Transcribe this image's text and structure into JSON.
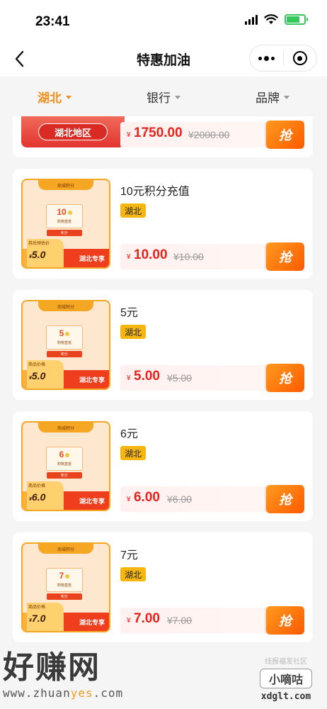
{
  "status": {
    "time": "23:41"
  },
  "nav": {
    "title": "特惠加油"
  },
  "filters": [
    {
      "label": "湖北",
      "active": true
    },
    {
      "label": "银行",
      "active": false
    },
    {
      "label": "品牌",
      "active": false
    }
  ],
  "top_card": {
    "badge": "湖北地区",
    "currency": "¥",
    "price": "1750.00",
    "old_price": "¥2000.00",
    "button": "抢"
  },
  "items": [
    {
      "title": "10元积分充值",
      "tag": "湖北",
      "currency": "¥",
      "price": "10.00",
      "old_price": "¥10.00",
      "button": "抢",
      "thumb": {
        "header": "商城积分",
        "coupon_value": "10",
        "coupon_sub": "购物直抵",
        "coupon_label": "积分",
        "foot_label": "券后预估价",
        "foot_price": "5.0",
        "foot_right": "湖北专享"
      }
    },
    {
      "title": "5元",
      "tag": "湖北",
      "currency": "¥",
      "price": "5.00",
      "old_price": "¥5.00",
      "button": "抢",
      "thumb": {
        "header": "商城积分",
        "coupon_value": "5",
        "coupon_sub": "购物直抵",
        "coupon_label": "积分",
        "foot_label": "商品价格",
        "foot_price": "5.0",
        "foot_right": "湖北专享"
      }
    },
    {
      "title": "6元",
      "tag": "湖北",
      "currency": "¥",
      "price": "6.00",
      "old_price": "¥6.00",
      "button": "抢",
      "thumb": {
        "header": "商城积分",
        "coupon_value": "6",
        "coupon_sub": "购物直抵",
        "coupon_label": "积分",
        "foot_label": "商品价格",
        "foot_price": "6.0",
        "foot_right": "湖北专享"
      }
    },
    {
      "title": "7元",
      "tag": "湖北",
      "currency": "¥",
      "price": "7.00",
      "old_price": "¥7.00",
      "button": "抢",
      "thumb": {
        "header": "商城积分",
        "coupon_value": "7",
        "coupon_sub": "购物直抵",
        "coupon_label": "积分",
        "foot_label": "商品价格",
        "foot_price": "7.0",
        "foot_right": "湖北专享"
      }
    }
  ],
  "watermark": {
    "brand": "好赚网",
    "url_pre": "www.zhuan",
    "url_mid": "yes",
    "url_post": ".com",
    "right_small": "线报福发社区",
    "right_box": "小嘀咕",
    "right_domain": "xdglt.com"
  },
  "colors": {
    "accent": "#f2901e",
    "price_red": "#e7231b",
    "tag_yellow": "#f5b60f",
    "button_orange": "#ff7a10"
  }
}
